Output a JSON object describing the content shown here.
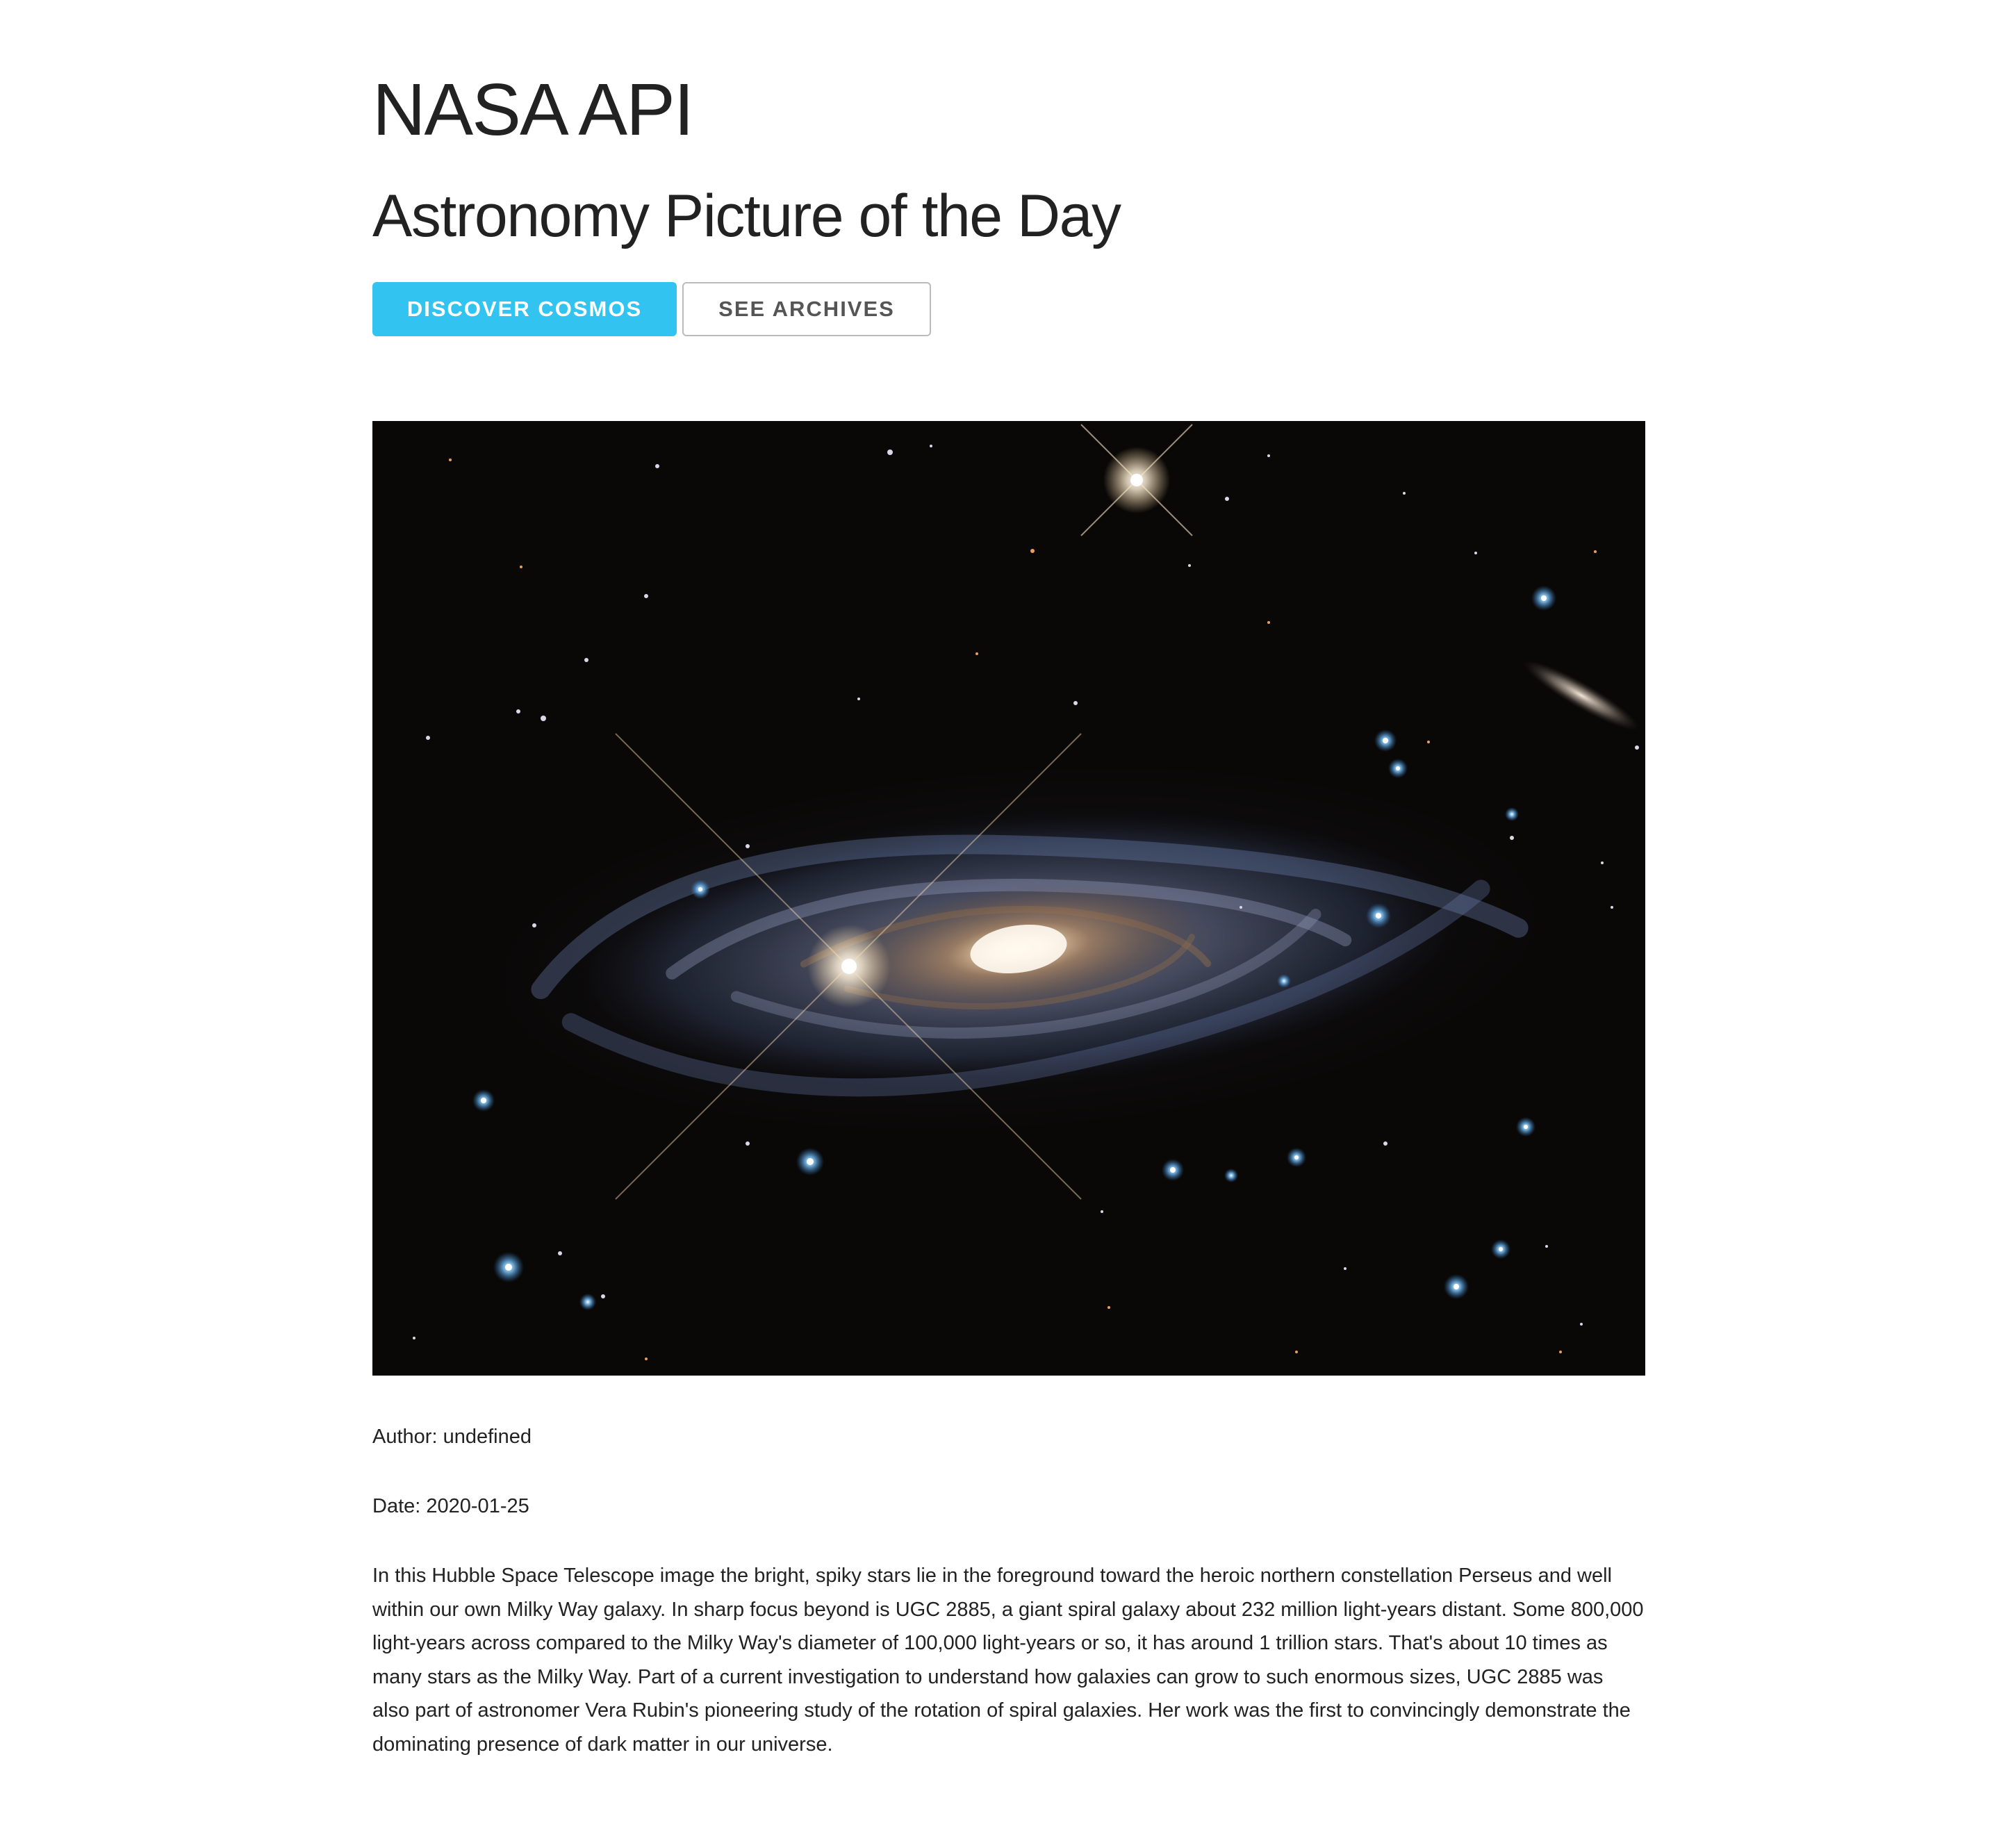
{
  "header": {
    "title": "NASA API",
    "subtitle": "Astronomy Picture of the Day"
  },
  "actions": {
    "primary_label": "DISCOVER COSMOS",
    "secondary_label": "SEE ARCHIVES"
  },
  "colors": {
    "primary_button": "#33c3f0",
    "secondary_border": "#bbbbbb",
    "text": "#222222",
    "image_background": "#0a0807"
  },
  "apod": {
    "author_label": "Author:",
    "author_value": "undefined",
    "date_label": "Date:",
    "date_value": "2020-01-25",
    "explanation": "In this Hubble Space Telescope image the bright, spiky stars lie in the foreground toward the heroic northern constellation Perseus and well within our own Milky Way galaxy. In sharp focus beyond is UGC 2885, a giant spiral galaxy about 232 million light-years distant. Some 800,000 light-years across compared to the Milky Way's diameter of 100,000 light-years or so, it has around 1 trillion stars. That's about 10 times as many stars as the Milky Way. Part of a current investigation to understand how galaxies can grow to such enormous sizes, UGC 2885 was also part of astronomer Vera Rubin's pioneering study of the rotation of spiral galaxies. Her work was the first to convincingly demonstrate the dominating presence of dark matter in our universe."
  }
}
